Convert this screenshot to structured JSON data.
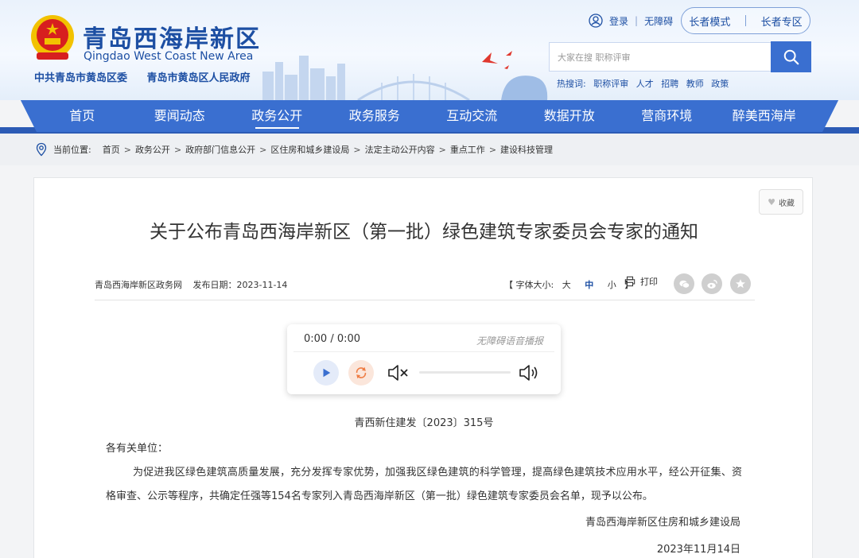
{
  "header": {
    "site_title": "青岛西海岸新区",
    "site_subtitle": "Qingdao West Coast New Area",
    "org_1": "中共青岛市黄岛区委",
    "org_2": "青岛市黄岛区人民政府",
    "login": "登录",
    "accessible": "无障碍",
    "elder_mode": "长者模式",
    "elder_zone": "长者专区",
    "search_placeholder": "大家在搜 职称评审",
    "hot_label": "热搜词:",
    "hot_words": [
      "职称评审",
      "人才",
      "招聘",
      "教师",
      "政策"
    ]
  },
  "nav": {
    "items": [
      "首页",
      "要闻动态",
      "政务公开",
      "政务服务",
      "互动交流",
      "数据开放",
      "营商环境",
      "醉美西海岸"
    ],
    "active_index": 2
  },
  "breadcrumb": {
    "label": "当前位置:",
    "items": [
      "首页",
      "政务公开",
      "政府部门信息公开",
      "区住房和城乡建设局",
      "法定主动公开内容",
      "重点工作",
      "建设科技管理"
    ]
  },
  "article": {
    "collect": "收藏",
    "title": "关于公布青岛西海岸新区（第一批）绿色建筑专家委员会专家的通知",
    "source": "青岛西海岸新区政务网",
    "date": "发布日期：2023-11-14",
    "font_label": "【 字体大小:",
    "font_large": "大",
    "font_mid": "中",
    "font_small": "小",
    "font_end": "】",
    "print": "打印",
    "doc_no": "青西新住建发〔2023〕315号",
    "greeting": "各有关单位：",
    "paragraph": "为促进我区绿色建筑高质量发展，充分发挥专家优势，加强我区绿色建筑的科学管理，提高绿色建筑技术应用水平，经公开征集、资格审查、公示等程序，共确定任强等154名专家列入青岛西海岸新区（第一批）绿色建筑专家委员会名单，现予以公布。",
    "signer": "青岛西海岸新区住房和城乡建设局",
    "sign_date": "2023年11月14日"
  },
  "player": {
    "time": "0:00 / 0:00",
    "label": "无障碍语音播报"
  },
  "colors": {
    "brand": "#1d4fa3",
    "nav": "#3a6fd0",
    "nav_dark": "#2c5bb5"
  }
}
